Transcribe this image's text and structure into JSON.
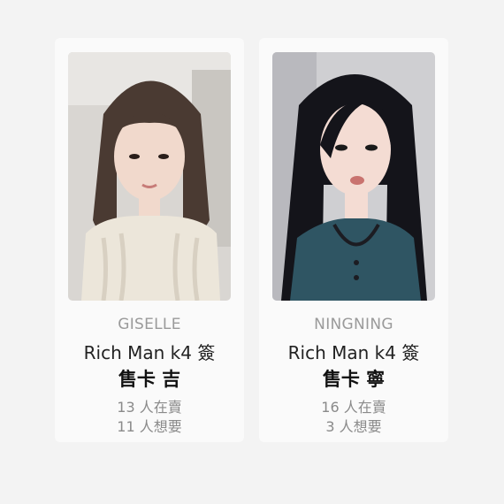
{
  "cards": [
    {
      "member": "GISELLE",
      "title": "Rich Man k4 簽",
      "subtitle": "售卡 吉",
      "selling": "13 人在賣",
      "wanting": "11 人想要",
      "photo": {
        "bg": "#d9d6d2",
        "hair": "#4a3a32",
        "skin": "#f1d9cc",
        "top": "#ece6da"
      }
    },
    {
      "member": "NINGNING",
      "title": "Rich Man k4 簽",
      "subtitle": "售卡 寧",
      "selling": "16 人在賣",
      "wanting": "3 人想要",
      "photo": {
        "bg": "#cfcfd2",
        "hair": "#14141a",
        "skin": "#f4dcd3",
        "top": "#2f5563"
      }
    }
  ]
}
